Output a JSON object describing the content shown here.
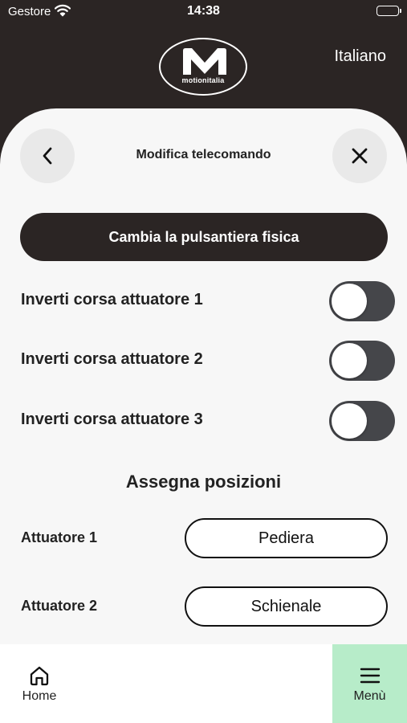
{
  "status_bar": {
    "carrier": "Gestore",
    "time": "14:38"
  },
  "header": {
    "logo_text": "motionitalia",
    "language": "Italiano"
  },
  "sheet": {
    "title": "Modifica telecomando",
    "back_icon": "chevron-left-icon",
    "close_icon": "close-icon",
    "primary_button": "Cambia la pulsantiera fisica"
  },
  "toggles": [
    {
      "label": "Inverti corsa attuatore 1",
      "on": false
    },
    {
      "label": "Inverti corsa attuatore 2",
      "on": false
    },
    {
      "label": "Inverti corsa attuatore 3",
      "on": false
    }
  ],
  "assign": {
    "title": "Assegna posizioni",
    "rows": [
      {
        "label": "Attuatore 1",
        "value": "Pediera"
      },
      {
        "label": "Attuatore 2",
        "value": "Schienale"
      }
    ]
  },
  "tabbar": {
    "home": {
      "label": "Home",
      "icon": "home-icon"
    },
    "menu": {
      "label": "Menù",
      "icon": "hamburger-menu-icon",
      "active_color": "#b7ecc9"
    }
  },
  "colors": {
    "header_bg": "#2b2524",
    "sheet_bg": "#f7f7f7",
    "toggle_off": "#45464a"
  }
}
